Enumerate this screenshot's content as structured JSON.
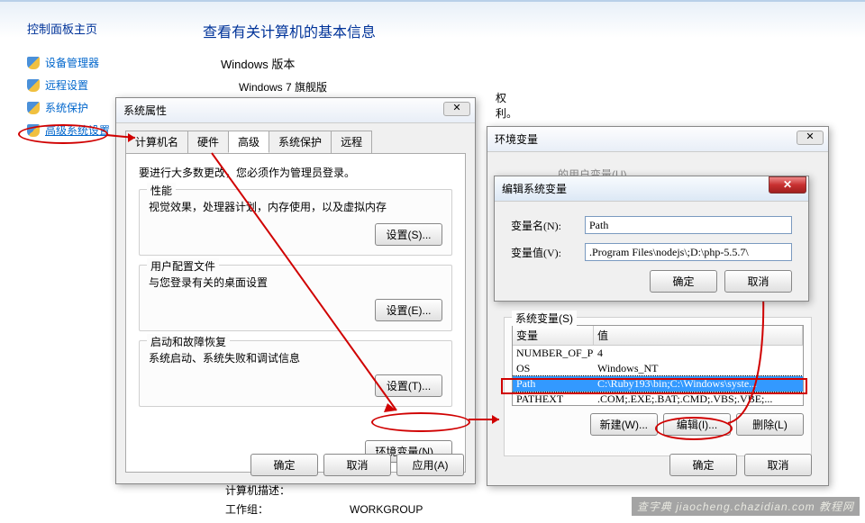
{
  "sidebar": {
    "title": "控制面板主页",
    "items": [
      {
        "label": "设备管理器"
      },
      {
        "label": "远程设置"
      },
      {
        "label": "系统保护"
      },
      {
        "label": "高级系统设置"
      }
    ]
  },
  "main": {
    "heading": "查看有关计算机的基本信息",
    "edition_label": "Windows 版本",
    "edition_value": "Windows 7 旗舰版",
    "copyright_tail": "权利。",
    "desc_label": "计算机描述：",
    "workgroup_label": "工作组：",
    "workgroup_value": "WORKGROUP"
  },
  "sysprop": {
    "title": "系统属性",
    "tabs": [
      "计算机名",
      "硬件",
      "高级",
      "系统保护",
      "远程"
    ],
    "note": "要进行大多数更改，您必须作为管理员登录。",
    "perf": {
      "title": "性能",
      "desc": "视觉效果，处理器计划，内存使用，以及虚拟内存",
      "btn": "设置(S)..."
    },
    "user": {
      "title": "用户配置文件",
      "desc": "与您登录有关的桌面设置",
      "btn": "设置(E)..."
    },
    "startup": {
      "title": "启动和故障恢复",
      "desc": "系统启动、系统失败和调试信息",
      "btn": "设置(T)..."
    },
    "env_btn": "环境变量(N)...",
    "ok": "确定",
    "cancel": "取消",
    "apply": "应用(A)"
  },
  "envvars": {
    "title": "环境变量",
    "user_group_title": "的用户变量(U)",
    "sys_group_title": "系统变量(S)",
    "col_var": "变量",
    "col_val": "值",
    "rows": [
      {
        "var": "NUMBER_OF_PR...",
        "val": "4"
      },
      {
        "var": "OS",
        "val": "Windows_NT"
      },
      {
        "var": "Path",
        "val": "C:\\Ruby193\\bin;C:\\Windows\\syste..."
      },
      {
        "var": "PATHEXT",
        "val": ".COM;.EXE;.BAT;.CMD;.VBS;.VBE;..."
      }
    ],
    "new": "新建(W)...",
    "edit": "编辑(I)...",
    "delete": "删除(L)",
    "ok": "确定",
    "cancel": "取消"
  },
  "editvar": {
    "title": "编辑系统变量",
    "name_label": "变量名(N):",
    "name_value": "Path",
    "value_label": "变量值(V):",
    "value_value": ".Program Files\\nodejs\\;D:\\php-5.5.7\\",
    "ok": "确定",
    "cancel": "取消"
  },
  "watermark": "查字典  jiaocheng.chazidian.com  教程网"
}
